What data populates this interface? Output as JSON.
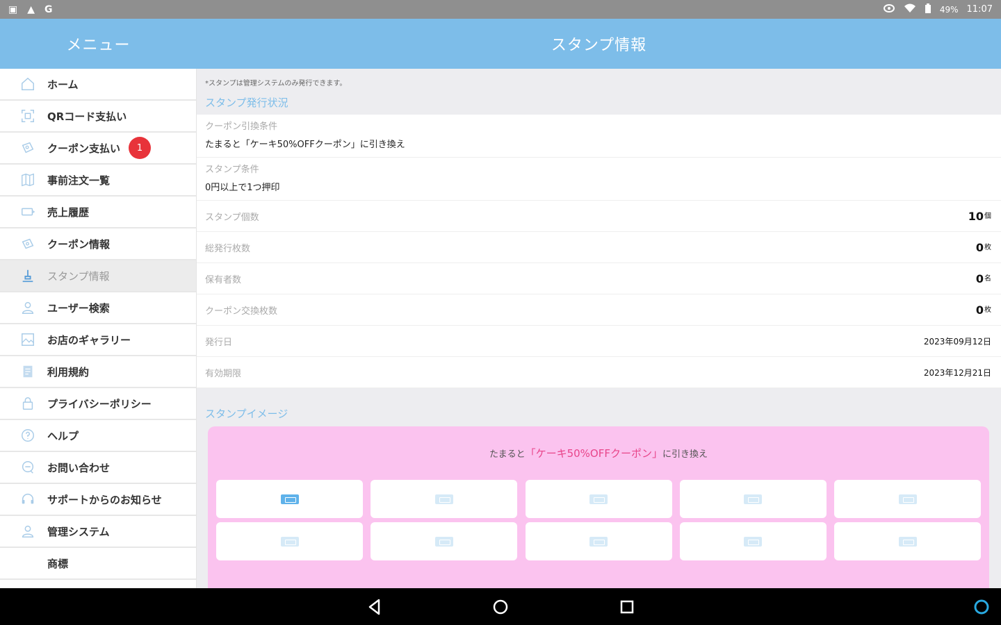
{
  "status_bar": {
    "left_icons": [
      "image-icon",
      "warning-icon",
      "g-icon"
    ],
    "left_glyphs": [
      "▣",
      "▲",
      "G"
    ],
    "battery": "49%",
    "time": "11:07"
  },
  "header": {
    "menu_title": "メニュー",
    "page_title": "スタンプ情報"
  },
  "sidebar": {
    "items": [
      {
        "label": "ホーム",
        "icon": "home-icon"
      },
      {
        "label": "QRコード支払い",
        "icon": "qr-scan-icon"
      },
      {
        "label": "クーポン支払い",
        "icon": "coupon-pay-icon",
        "badge": "1"
      },
      {
        "label": "事前注文一覧",
        "icon": "map-icon"
      },
      {
        "label": "売上履歴",
        "icon": "ticket-icon"
      },
      {
        "label": "クーポン情報",
        "icon": "coupon-icon"
      },
      {
        "label": "スタンプ情報",
        "icon": "stamp-icon",
        "active": true
      },
      {
        "label": "ユーザー検索",
        "icon": "user-icon"
      },
      {
        "label": "お店のギャラリー",
        "icon": "gallery-icon"
      },
      {
        "label": "利用規約",
        "icon": "document-icon"
      },
      {
        "label": "プライバシーポリシー",
        "icon": "lock-icon"
      },
      {
        "label": "ヘルプ",
        "icon": "help-icon"
      },
      {
        "label": "お問い合わせ",
        "icon": "chat-icon"
      },
      {
        "label": "サポートからのお知らせ",
        "icon": "headset-icon"
      },
      {
        "label": "管理システム",
        "icon": "admin-user-icon"
      },
      {
        "label": "商標",
        "icon": ""
      }
    ]
  },
  "main": {
    "note": "*スタンプは管理システムのみ発行できます。",
    "issue_section_title": "スタンプ発行状況",
    "coupon_condition_label": "クーポン引換条件",
    "coupon_condition_value": "たまると「ケーキ50%OFFクーポン」に引き換え",
    "stamp_condition_label": "スタンプ条件",
    "stamp_condition_value": "0円以上で1つ押印",
    "rows": [
      {
        "label": "スタンプ個数",
        "value": "10",
        "unit": "個"
      },
      {
        "label": "総発行枚数",
        "value": "0",
        "unit": "枚"
      },
      {
        "label": "保有者数",
        "value": "0",
        "unit": "名"
      },
      {
        "label": "クーポン交換枚数",
        "value": "0",
        "unit": "枚"
      },
      {
        "label": "発行日",
        "value": "2023年09月12日",
        "unit": ""
      },
      {
        "label": "有効期限",
        "value": "2023年12月21日",
        "unit": ""
      }
    ],
    "image_section_title": "スタンプイメージ",
    "stamp_card": {
      "prefix": "たまると",
      "highlight": "「ケーキ50%OFFクーポン」",
      "suffix": "に引き換え",
      "total": 10,
      "filled": 1
    }
  },
  "colors": {
    "header": "#7dbde9",
    "accent": "#7dbde9",
    "badge": "#e8333a",
    "stamp_card": "#fbc3ef",
    "highlight": "#e8458a"
  }
}
